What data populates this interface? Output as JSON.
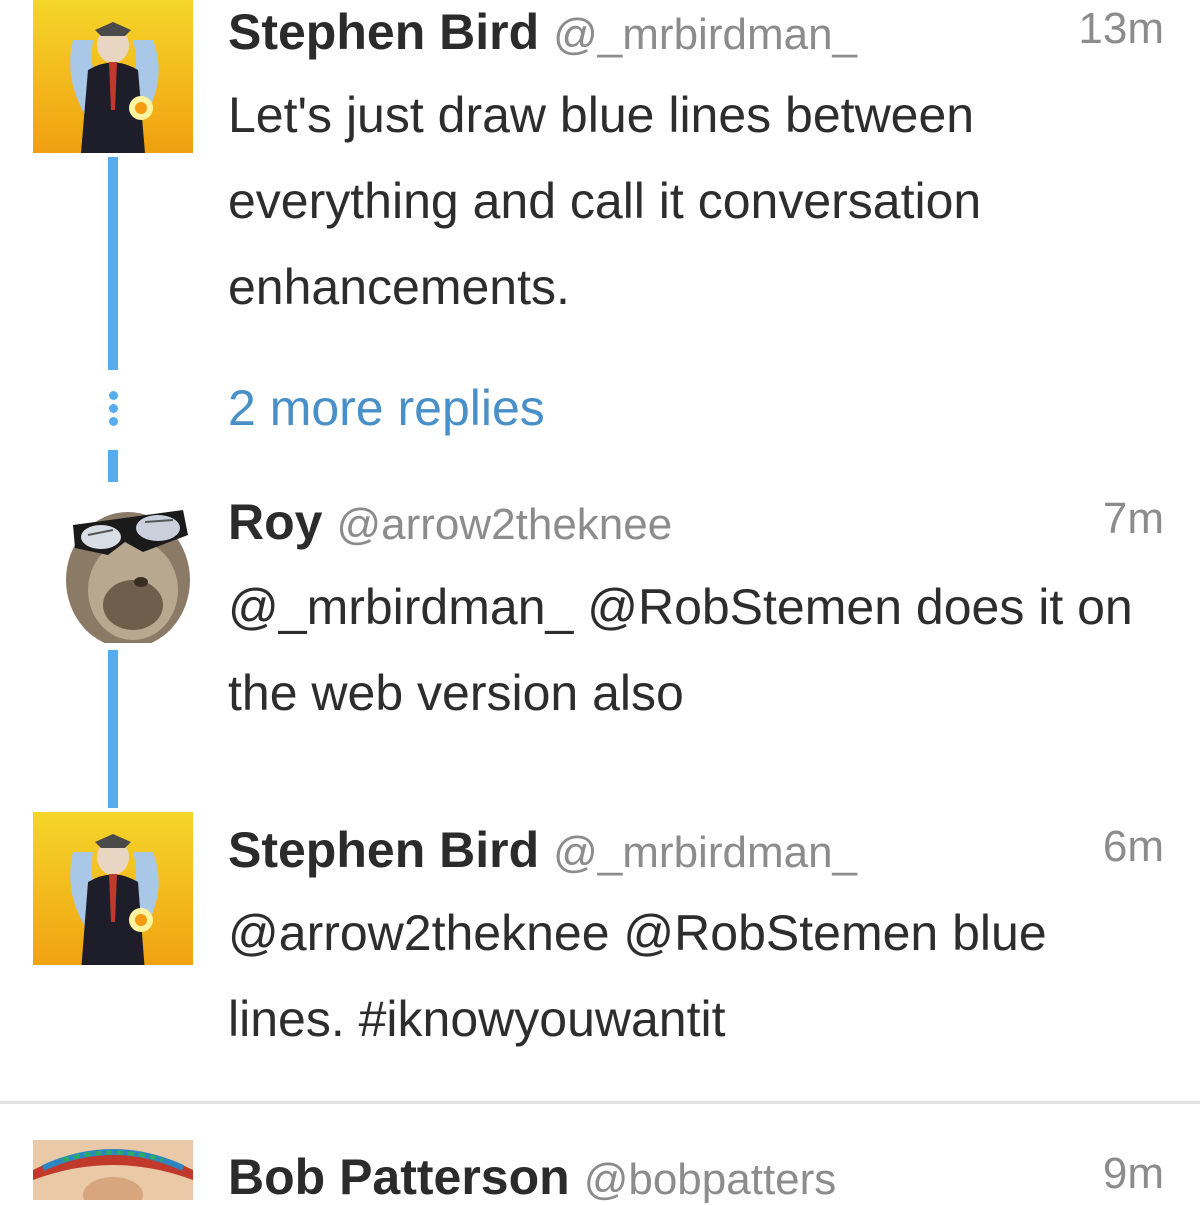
{
  "tweets": [
    {
      "name": "Stephen Bird",
      "handle": "@_mrbirdman_",
      "time": "13m",
      "lines": [
        "Let's just draw blue lines between",
        "everything and call it conversation",
        "enhancements."
      ]
    },
    {
      "name": "Roy",
      "handle": "@arrow2theknee",
      "time": "7m",
      "lines": [
        "@_mrbirdman_ @RobStemen does it on",
        "the web version also"
      ]
    },
    {
      "name": "Stephen Bird",
      "handle": "@_mrbirdman_",
      "time": "6m",
      "lines": [
        "@arrow2theknee @RobStemen blue",
        "lines.  #iknowyouwantit"
      ]
    },
    {
      "name": "Bob Patterson",
      "handle": "@bobpatters",
      "time": "9m",
      "lines": []
    }
  ],
  "more_replies": "2 more replies",
  "colors": {
    "thread_line": "#55acee",
    "link": "#4a90c8",
    "handle": "#8c8c8c"
  },
  "icons": [
    "avatar-bird-man",
    "avatar-sloth-sunglasses",
    "avatar-bird-man",
    "avatar-sombrero-man"
  ]
}
